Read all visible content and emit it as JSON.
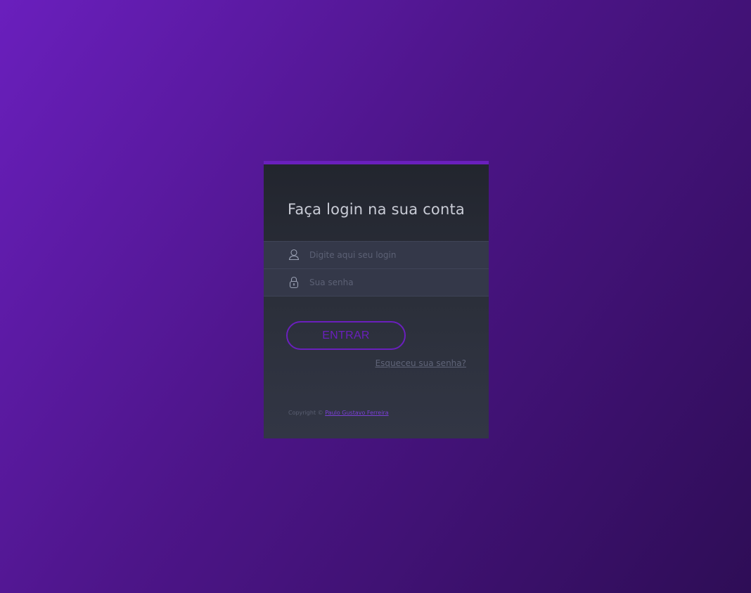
{
  "login": {
    "title": "Faça login na sua conta",
    "username": {
      "value": "",
      "placeholder": "Digite aqui seu login",
      "icon": "user-icon"
    },
    "password": {
      "value": "",
      "placeholder": "Sua senha",
      "icon": "lock-icon"
    },
    "submit_label": "ENTRAR",
    "forgot_label": "Esqueceu sua senha?"
  },
  "footer": {
    "copyright_label": "Copyright ©",
    "author": "Paulo Gustavo Ferreira"
  },
  "colors": {
    "accent": "#6a1fbd",
    "card_background": "#2b2f3a",
    "field_background": "#343849",
    "background_start": "#6a1fbd",
    "background_end": "#2e0d56"
  }
}
